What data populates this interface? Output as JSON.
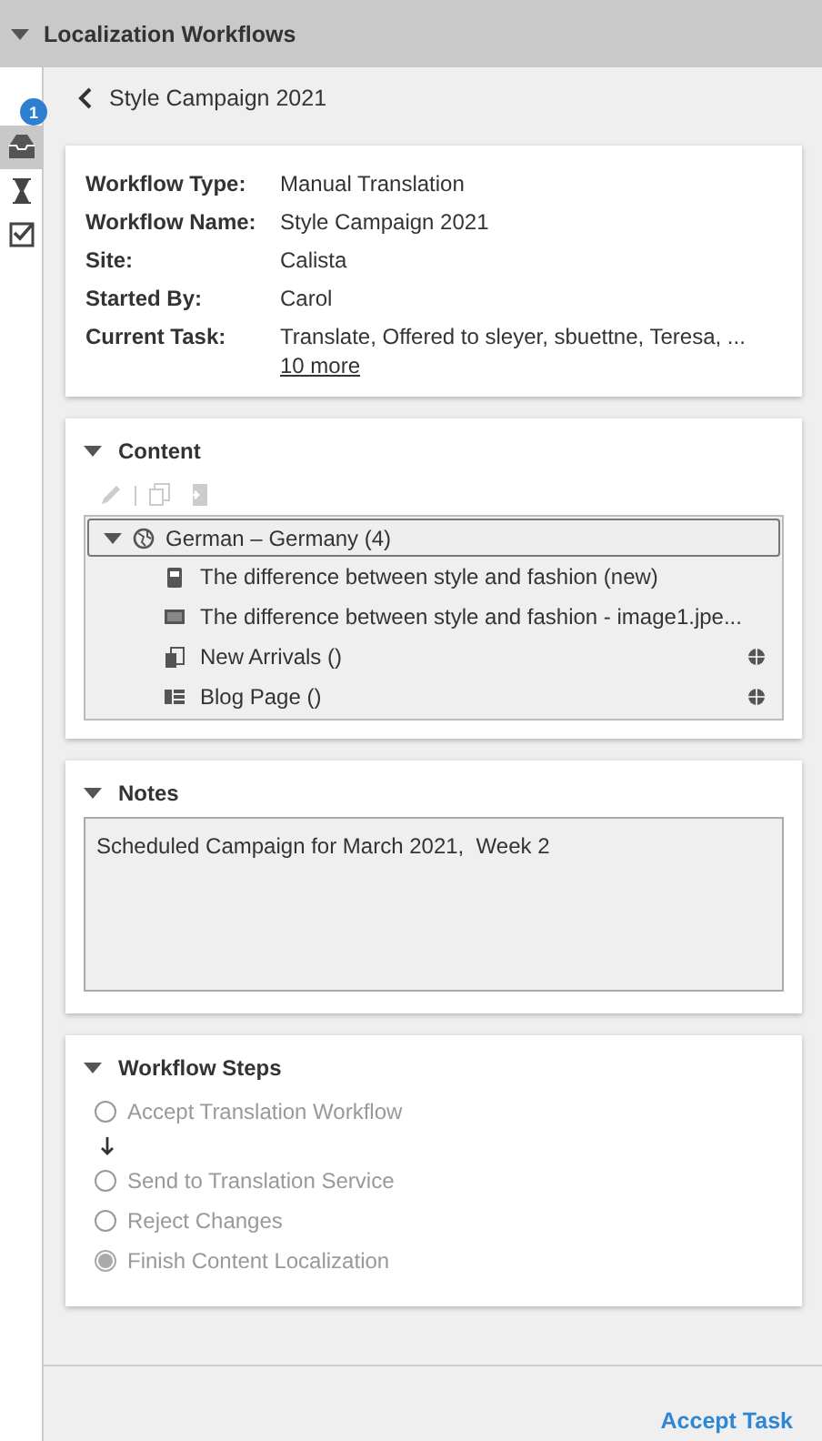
{
  "panel": {
    "title": "Localization Workflows",
    "expanded": true
  },
  "rail": [
    {
      "kind": "inbox",
      "selected": true,
      "badge": "1"
    },
    {
      "kind": "hourglass",
      "selected": false
    },
    {
      "kind": "checklist",
      "selected": false
    }
  ],
  "back_title": "Style Campaign 2021",
  "details": [
    {
      "label": "Workflow Type:",
      "value": "Manual Translation"
    },
    {
      "label": "Workflow Name:",
      "value": "Style Campaign 2021"
    },
    {
      "label": "Site:",
      "value": "Calista"
    },
    {
      "label": "Started By:",
      "value": "Carol"
    },
    {
      "label": "Current Task:",
      "value": "Translate, Offered to sleyer, sbuettne, Teresa, ...",
      "link": "10 more"
    }
  ],
  "content": {
    "title": "Content",
    "expanded": true,
    "toolbar": [
      {
        "kind": "edit",
        "disabled": true
      },
      {
        "kind": "copy",
        "disabled": true
      },
      {
        "kind": "open",
        "disabled": true
      }
    ],
    "tree": [
      {
        "label": "German – Germany (4)",
        "expanded": true,
        "selected": true,
        "children": [
          {
            "kind": "article",
            "label": "The difference between style and fashion (new)",
            "globe": false
          },
          {
            "kind": "image",
            "label": "The difference between style and fashion - image1.jpe...",
            "globe": false
          },
          {
            "kind": "page",
            "label": "New Arrivals ()",
            "globe": true
          },
          {
            "kind": "list",
            "label": "Blog Page ()",
            "globe": true
          }
        ]
      }
    ]
  },
  "notes": {
    "title": "Notes",
    "expanded": true,
    "value": "Scheduled Campaign for March 2021,  Week 2"
  },
  "steps": {
    "title": "Workflow Steps",
    "expanded": true,
    "items": [
      {
        "kind": "step",
        "label": "Accept Translation Workflow",
        "selected": false
      },
      {
        "kind": "arrow"
      },
      {
        "kind": "step",
        "label": "Send to Translation Service",
        "selected": false
      },
      {
        "kind": "step",
        "label": "Reject Changes",
        "selected": false
      },
      {
        "kind": "step",
        "label": "Finish Content Localization",
        "selected": true
      }
    ]
  },
  "footer": {
    "action": "Accept Task"
  }
}
